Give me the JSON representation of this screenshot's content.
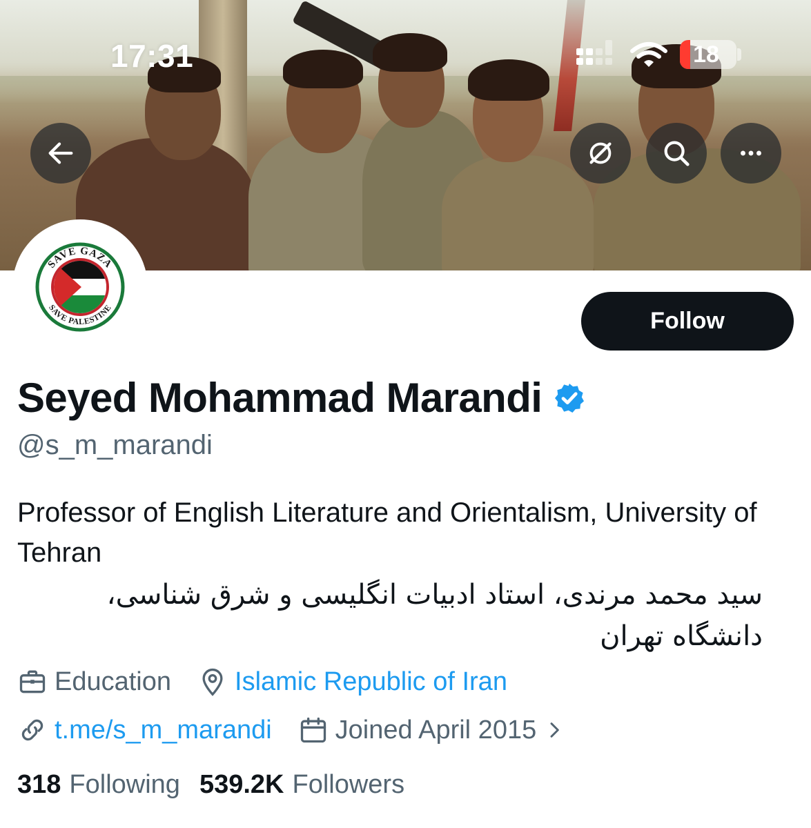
{
  "status_bar": {
    "time": "17:31",
    "battery_level": "18",
    "battery_low_color": "#ff3b30"
  },
  "header": {
    "back_icon": "arrow-left-icon",
    "grok_icon": "grok-slash-circle-icon",
    "search_icon": "search-icon",
    "more_icon": "more-horizontal-icon"
  },
  "banner": {
    "description_icon": "banner-photo"
  },
  "avatar": {
    "logo_top": "SAVE GAZA",
    "logo_bottom": "SAVE PALESTINE"
  },
  "profile": {
    "follow_label": "Follow",
    "display_name": "Seyed Mohammad Marandi",
    "handle": "@s_m_marandi",
    "bio_en": "Professor of English Literature and Orientalism, University of Tehran",
    "bio_fa": "سید محمد مرندی، استاد ادبیات انگلیسی و شرق شناسی، دانشگاه تهران",
    "category": "Education",
    "location": "Islamic Republic of Iran",
    "website": "t.me/s_m_marandi",
    "joined": "Joined April 2015",
    "following_count": "318",
    "following_label": "Following",
    "followers_count": "539.2K",
    "followers_label": "Followers"
  },
  "colors": {
    "link": "#1d9bf0",
    "secondary_text": "#536471",
    "primary_text": "#0f1419",
    "verified": "#1d9bf0"
  }
}
